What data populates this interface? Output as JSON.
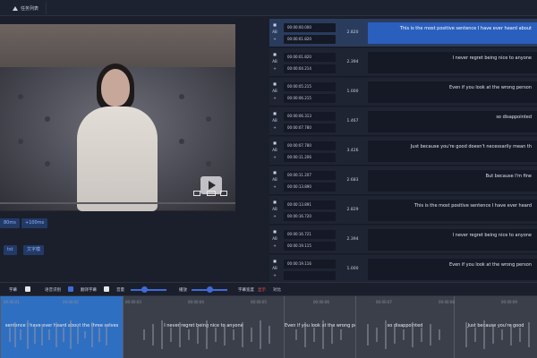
{
  "topbar": {
    "task_button_label": "任务列表"
  },
  "video": {
    "has_play_button": true
  },
  "chips": [
    {
      "label": "80ms"
    },
    {
      "label": "+100ms"
    },
    {
      "label": "tst"
    },
    {
      "label": "文字模"
    }
  ],
  "subtitles": [
    {
      "start": "00:00:00.000",
      "end": "00:00:01.820",
      "duration": "2.820",
      "text": "This is the most positive sentence I have ever heard about",
      "active": true
    },
    {
      "start": "00:00:01.820",
      "end": "00:00:04.214",
      "duration": "2.394",
      "text": "I never regret being nice to anyone"
    },
    {
      "start": "00:00:05.215",
      "end": "00:00:06.215",
      "duration": "1.000",
      "text": "Even if you look at the wrong person"
    },
    {
      "start": "00:00:06.313",
      "end": "00:00:07.780",
      "duration": "1.467",
      "text": "so disappointed"
    },
    {
      "start": "00:00:07.780",
      "end": "00:00:11.206",
      "duration": "3.426",
      "text": "Just because you're good doesn't necessarily mean th"
    },
    {
      "start": "00:00:11.207",
      "end": "00:00:13.890",
      "duration": "2.683",
      "text": "But because I'm fine"
    },
    {
      "start": "00:00:13.891",
      "end": "00:00:16.720",
      "duration": "2.829",
      "text": "This is the most positive sentence I have ever heard"
    },
    {
      "start": "00:00:16.721",
      "end": "00:00:19.115",
      "duration": "2.394",
      "text": "I never regret being nice to anyone"
    },
    {
      "start": "00:00:19.116",
      "end": "",
      "duration": "1.000",
      "text": "Even if you look at the wrong person"
    }
  ],
  "toolbar": {
    "labels": [
      "字幕",
      "语音识别",
      "翻译字幕",
      "音量",
      "播放",
      "字幕宽度",
      "显示",
      "对比"
    ]
  },
  "timeline": {
    "ticks": [
      "00:00:01",
      "00:00:02",
      "00:00:03",
      "00:00:04",
      "00:00:05",
      "00:00:06",
      "00:00:07",
      "00:00:08",
      "00:00:09"
    ],
    "segments": [
      {
        "text": "sentence I have ever heard about the three selves",
        "active": true
      },
      {
        "text": "I never regret being nice to anyone"
      },
      {
        "text": "Even if you look at the wrong person"
      },
      {
        "text": "so disappointed"
      },
      {
        "text": "Just because you're good"
      }
    ]
  }
}
